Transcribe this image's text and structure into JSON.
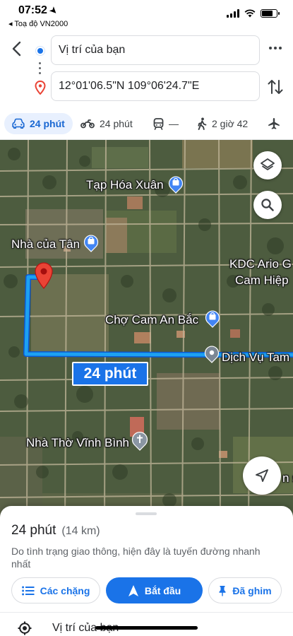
{
  "status_bar": {
    "time": "07:52",
    "back_label": "◂ Toạ độ VN2000",
    "battery_level": 0.75
  },
  "route": {
    "origin": "Vị trí của bạn",
    "destination": "12°01'06.5\"N 109°06'24.7\"E"
  },
  "modes": [
    {
      "name": "car",
      "label": "24 phút",
      "active": true
    },
    {
      "name": "motorbike",
      "label": "24 phút"
    },
    {
      "name": "transit",
      "label": "—"
    },
    {
      "name": "walk",
      "label": "2 giờ 42"
    },
    {
      "name": "flight",
      "label": ""
    }
  ],
  "map": {
    "labels": {
      "tap_hoa_xuan": "Tạp Hóa Xuân",
      "nha_cua_tan": "Nhà của Tân",
      "kdc_ario_1": "KDC Ario G",
      "kdc_ario_2": "Cam Hiệp",
      "cho_cam_an_bac": "Chợ Cam An Bắc",
      "dich_vu_tam": "Dịch Vụ Tam",
      "nha_tho_vinh_binh": "Nhà Thờ Vĩnh Bình",
      "edge_label": "n s"
    },
    "route_badge": "24 phút"
  },
  "sheet": {
    "eta": "24 phút",
    "distance": "(14 km)",
    "description": "Do tình trạng giao thông, hiện đây là tuyến đường nhanh nhất",
    "steps_button": "Các chặng",
    "start_button": "Bắt đầu",
    "pinned_button": "Đã ghim",
    "bottom_origin": "Vị trí của bạn"
  },
  "colors": {
    "accent": "#1a73e8",
    "route_line": "#1da1f2",
    "pin": "#ea4335",
    "active_mode_bg": "#e8f0fe"
  }
}
